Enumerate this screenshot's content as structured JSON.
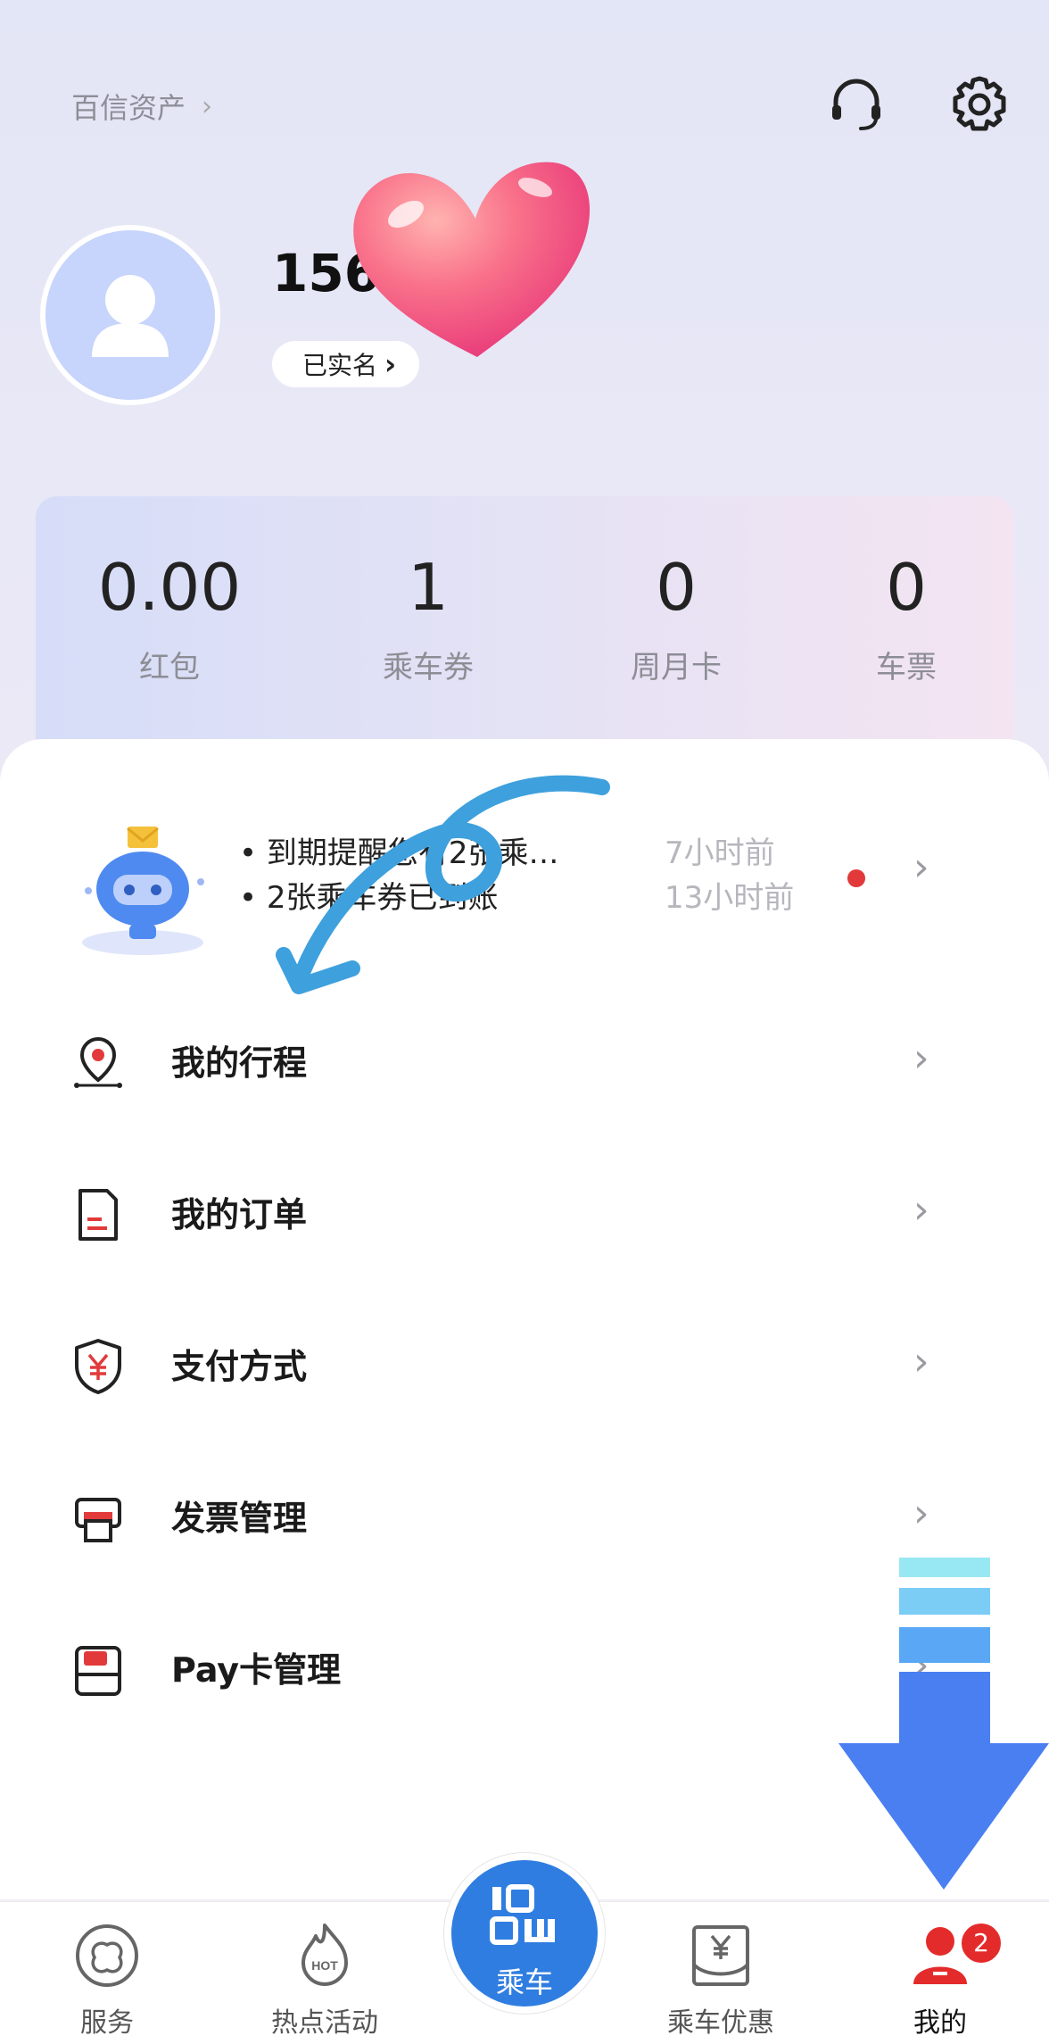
{
  "header": {
    "asset_link": "百信资产",
    "asset_chevron": "›",
    "headset_icon": "headset-icon",
    "settings_icon": "gear-icon"
  },
  "profile": {
    "phone": "156",
    "verified": "已实名",
    "verified_chevron": "›"
  },
  "stats": [
    {
      "value": "0.00",
      "label": "红包"
    },
    {
      "value": "1",
      "label": "乘车券"
    },
    {
      "value": "0",
      "label": "周月卡"
    },
    {
      "value": "0",
      "label": "车票"
    }
  ],
  "notices": [
    {
      "text": "• 到期提醒您有2张乘…",
      "time": "7小时前"
    },
    {
      "text": "• 2张乘车券已到账",
      "time": "13小时前"
    }
  ],
  "chevron": "›",
  "menu": [
    {
      "label": "我的行程",
      "icon": "location-pin-icon"
    },
    {
      "label": "我的订单",
      "icon": "document-icon"
    },
    {
      "label": "支付方式",
      "icon": "shield-yuan-icon"
    },
    {
      "label": "发票管理",
      "icon": "printer-icon"
    },
    {
      "label": "Pay卡管理",
      "icon": "pay-card-icon"
    }
  ],
  "tabs": [
    {
      "label": "服务",
      "icon": "service-icon"
    },
    {
      "label": "热点活动",
      "icon": "hot-flame-icon"
    },
    {
      "label": "乘车",
      "icon": "qr-code-icon"
    },
    {
      "label": "乘车优惠",
      "icon": "coupon-icon"
    },
    {
      "label": "我的",
      "icon": "user-icon"
    }
  ],
  "tab_badge": "2",
  "colors": {
    "accent": "#2f7de1",
    "alert_red": "#e23a3a",
    "overlay_arrow": "#4a86f5"
  }
}
